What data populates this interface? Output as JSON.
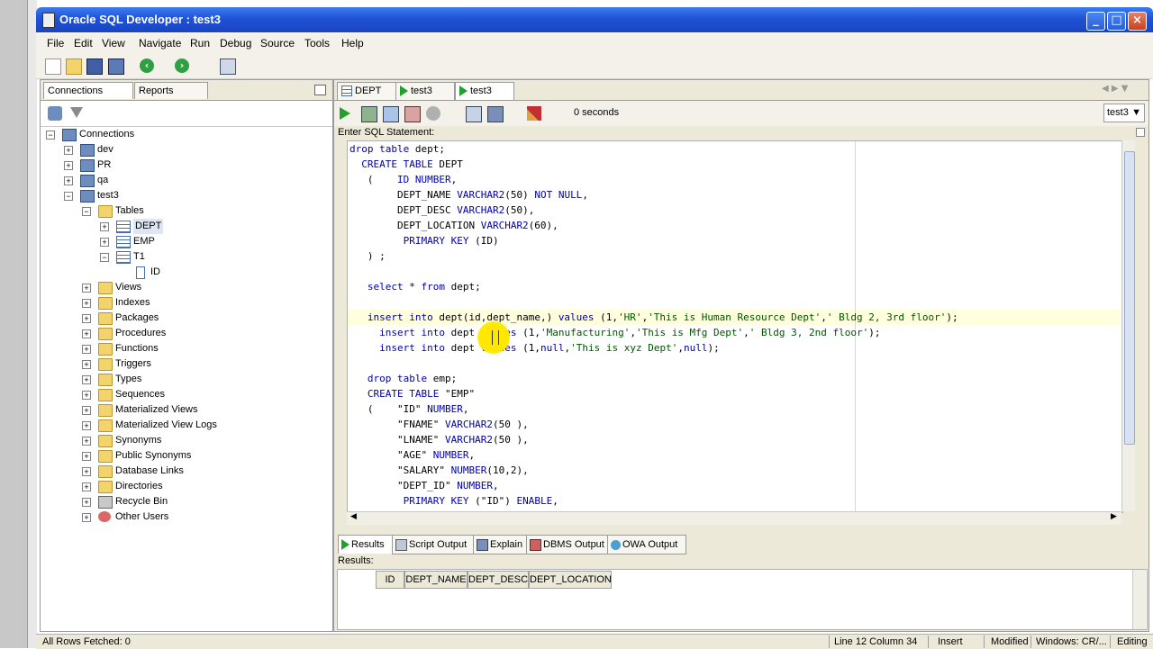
{
  "window": {
    "title": "Oracle SQL Developer : test3"
  },
  "menu": [
    "File",
    "Edit",
    "View",
    "Navigate",
    "Run",
    "Debug",
    "Source",
    "Tools",
    "Help"
  ],
  "left_panel": {
    "tabs": [
      "Connections",
      "Reports"
    ],
    "root": "Connections",
    "connections": [
      "dev",
      "PR",
      "qa",
      "test3"
    ],
    "tables_label": "Tables",
    "tables": [
      "DEPT",
      "EMP",
      "T1"
    ],
    "t1_columns": [
      "ID"
    ],
    "objects": [
      "Views",
      "Indexes",
      "Packages",
      "Procedures",
      "Functions",
      "Triggers",
      "Types",
      "Sequences",
      "Materialized Views",
      "Materialized View Logs",
      "Synonyms",
      "Public Synonyms",
      "Database Links",
      "Directories",
      "Recycle Bin",
      "Other Users"
    ]
  },
  "doc_tabs": [
    "DEPT",
    "test3",
    "test3"
  ],
  "sql_toolbar": {
    "timer": "0 seconds",
    "connection": "test3"
  },
  "editor": {
    "label": "Enter SQL Statement:"
  },
  "results": {
    "tabs": [
      "Results",
      "Script Output",
      "Explain",
      "DBMS Output",
      "OWA Output"
    ],
    "label": "Results:",
    "columns": [
      "ID",
      "DEPT_NAME",
      "DEPT_DESC",
      "DEPT_LOCATION"
    ]
  },
  "status": {
    "fetched": "All Rows Fetched: 0",
    "position": "Line 12 Column 34",
    "mode": "Insert",
    "modified": "Modified",
    "eol": "Windows: CR/...",
    "edit": "Editing"
  },
  "colors": {
    "title_bar": "#1f52d6",
    "keyword": "#0000a8",
    "run_green": "#22a02c"
  },
  "icons": [
    "app-icon",
    "new-icon",
    "open-icon",
    "save-icon",
    "save-all-icon",
    "back-icon",
    "forward-icon",
    "sql-worksheet-icon",
    "refresh-icon",
    "filter-icon",
    "run-statement-icon",
    "run-script-icon",
    "commit-icon",
    "rollback-icon",
    "cancel-icon",
    "sql-history-icon",
    "explain-plan-icon",
    "clear-icon"
  ]
}
